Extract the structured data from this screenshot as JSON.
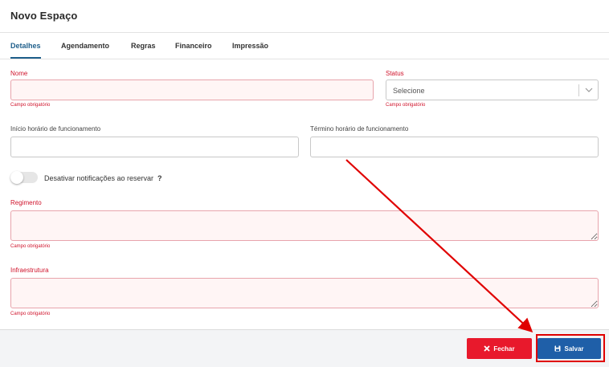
{
  "header": {
    "title": "Novo Espaço"
  },
  "tabs": [
    {
      "label": "Detalhes",
      "active": true
    },
    {
      "label": "Agendamento",
      "active": false
    },
    {
      "label": "Regras",
      "active": false
    },
    {
      "label": "Financeiro",
      "active": false
    },
    {
      "label": "Impressão",
      "active": false
    }
  ],
  "form": {
    "nome": {
      "label": "Nome",
      "value": "",
      "error": "Campo obrigatório"
    },
    "status": {
      "label": "Status",
      "selected": "Selecione",
      "error": "Campo obrigatório"
    },
    "inicio": {
      "label": "Início horário de funcionamento",
      "value": ""
    },
    "termino": {
      "label": "Término horário de funcionamento",
      "value": ""
    },
    "notificacoes": {
      "label": "Desativar notificações ao reservar",
      "help": "?",
      "enabled": false
    },
    "regimento": {
      "label": "Regimento",
      "value": "",
      "error": "Campo obrigatório"
    },
    "infraestrutura": {
      "label": "Infraestrutura",
      "value": "",
      "error": "Campo obrigatório"
    }
  },
  "footer": {
    "close_label": "Fechar",
    "save_label": "Salvar"
  },
  "colors": {
    "accent": "#1f5fa8",
    "danger": "#e8192c",
    "annotation": "#e00000"
  }
}
